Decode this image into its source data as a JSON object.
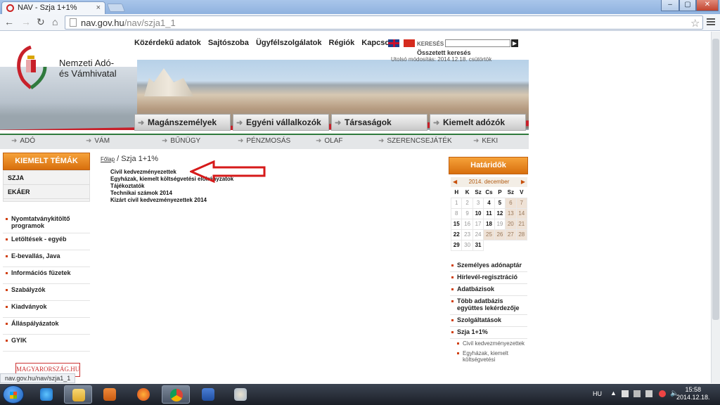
{
  "browser": {
    "tab_title": "NAV - Szja 1+1%",
    "tab_close": "×",
    "url_host": "nav.gov.hu",
    "url_path": "/nav/szja1_1",
    "window_buttons": [
      "–",
      "▢",
      "✕"
    ]
  },
  "site": {
    "logo_line1": "Nemzeti Adó-",
    "logo_line2": "és Vámhivatal",
    "top_links": [
      "Közérdekű adatok",
      "Sajtószoba",
      "Ügyfélszolgálatok",
      "Régiók",
      "Kapcsolat"
    ],
    "search_label": "KERESÉS",
    "advanced_search": "Összetett keresés",
    "last_modified": "Utolsó módosítás: 2014.12.18.   csütörtök",
    "main_tabs": [
      "Magánszemélyek",
      "Egyéni vállalkozók",
      "Társaságok",
      "Kiemelt adózók"
    ],
    "sub_nav": [
      "ADÓ",
      "VÁM",
      "BŰNÜGY",
      "PÉNZMOSÁS",
      "OLAF",
      "SZERENCSEJÁTÉK",
      "KEKI"
    ]
  },
  "left": {
    "featured_title": "KIEMELT TÉMÁK",
    "featured_items": [
      "SZJA",
      "EKÁER"
    ],
    "menu": [
      "Nyomtatványkitöltő programok",
      "Letöltések - egyéb",
      "E-bevallás, Java",
      "Információs füzetek",
      "Szabályzók",
      "Kiadványok",
      "Álláspályázatok",
      "GYIK"
    ],
    "partner_logo": "MAGYARORSZÁG.HU"
  },
  "center": {
    "breadcrumb_home": "Főlap",
    "breadcrumb_sep": " / ",
    "breadcrumb_current": "Szja 1+1%",
    "links": [
      "Civil kedvezményezettek",
      "Egyházak, kiemelt költségvetési előirányzatok",
      "Tájékoztatók",
      "Technikai számok 2014",
      "Kizárt civil kedvezményezettek 2014"
    ]
  },
  "right": {
    "deadlines_title": "Határidők",
    "calendar_month": "2014. december",
    "calendar_days": [
      "H",
      "K",
      "Sz",
      "Cs",
      "P",
      "Sz",
      "V"
    ],
    "calendar_rows": [
      [
        "1",
        "2",
        "3",
        "4",
        "5",
        "6",
        "7"
      ],
      [
        "8",
        "9",
        "10",
        "11",
        "12",
        "13",
        "14"
      ],
      [
        "15",
        "16",
        "17",
        "18",
        "19",
        "20",
        "21"
      ],
      [
        "22",
        "23",
        "24",
        "25",
        "26",
        "27",
        "28"
      ],
      [
        "29",
        "30",
        "31",
        "",
        "",
        "",
        ""
      ]
    ],
    "menu": [
      "Személyes adónaptár",
      "Hírlevél-regisztráció",
      "Adatbázisok",
      "Több adatbázis együttes lekérdezője",
      "Szolgáltatások",
      "Szja 1+1%"
    ],
    "sub_menu": [
      "Civil kedvezményezettek",
      "Egyházak, kiemelt költségvetési"
    ]
  },
  "status_url": "nav.gov.hu/nav/szja1_1",
  "taskbar": {
    "lang": "HU",
    "time": "15:58",
    "date": "2014.12.18."
  }
}
